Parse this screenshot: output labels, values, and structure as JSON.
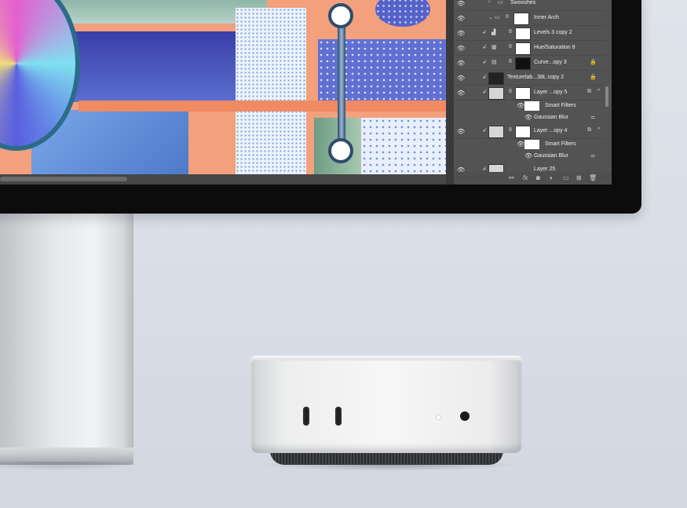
{
  "layers_panel": {
    "rows": [
      {
        "name": "Swooshes"
      },
      {
        "name": "Inner Arch"
      },
      {
        "name": "Levels 3 copy 2"
      },
      {
        "name": "Hue/Saturation 8"
      },
      {
        "name": "Curve...opy 3"
      },
      {
        "name": "Texturelab...38L copy 2"
      },
      {
        "name": "Layer ...opy 5"
      },
      {
        "name": "Layer ...opy 4"
      },
      {
        "name": "Layer 25"
      }
    ],
    "smart_filters_label": "Smart Filters",
    "gaussian_blur_label": "Gaussian Blur"
  },
  "colors": {
    "background": "#dadee6",
    "photoshop_panel": "#535353",
    "bezel": "#0c0c0d",
    "artwork_accent": "#f3a07d"
  },
  "icons": {
    "eye": "visibility-eye-icon",
    "folder": "folder-icon",
    "lock": "lock-icon",
    "link": "link-icon"
  }
}
